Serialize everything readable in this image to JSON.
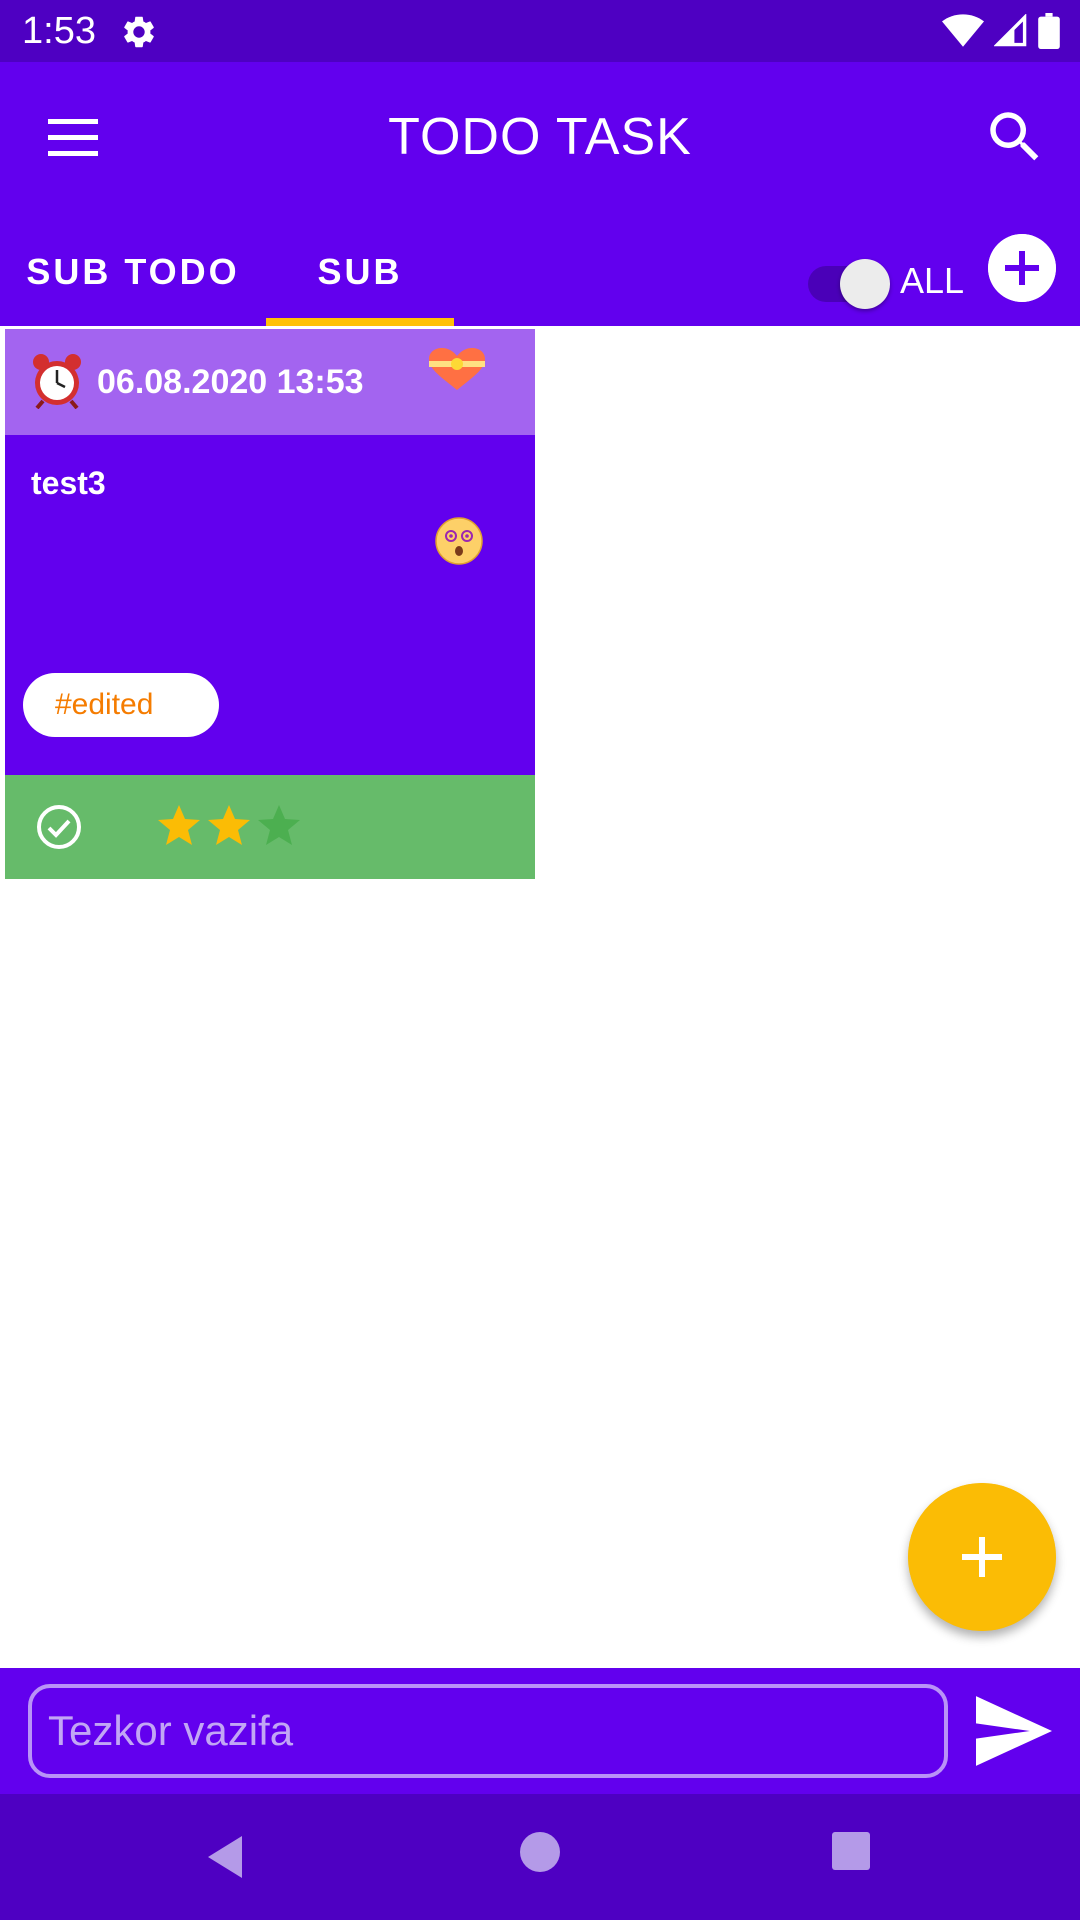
{
  "status_bar": {
    "time": "1:53",
    "icons": [
      "settings-icon",
      "wifi-icon",
      "signal-icon",
      "battery-icon"
    ]
  },
  "app_bar": {
    "title": "TODO TASK",
    "icons": [
      "menu-icon",
      "search-icon"
    ]
  },
  "tabs": [
    {
      "label": "SUB TODO",
      "selected": false
    },
    {
      "label": "SUB",
      "selected": true
    }
  ],
  "filter_toggle": {
    "label": "ALL",
    "on": true
  },
  "cards": [
    {
      "date": "06.08.2020 13:53",
      "title": "test3",
      "tag": "#edited",
      "rating": 2,
      "max_rating": 3,
      "done": true,
      "icons": [
        "alarm-clock-icon",
        "heart-gift-icon",
        "dizzy-face-icon",
        "check-circle-icon"
      ]
    }
  ],
  "quick_task": {
    "placeholder": "Tezkor vazifa",
    "value": ""
  },
  "colors": {
    "primary": "#6200ee",
    "primary_dark": "#4e00c2",
    "card_header": "#a364f0",
    "card_footer": "#66bb6a",
    "accent": "#ffc107",
    "fab": "#fbbc05",
    "tag_text": "#f57c00"
  }
}
